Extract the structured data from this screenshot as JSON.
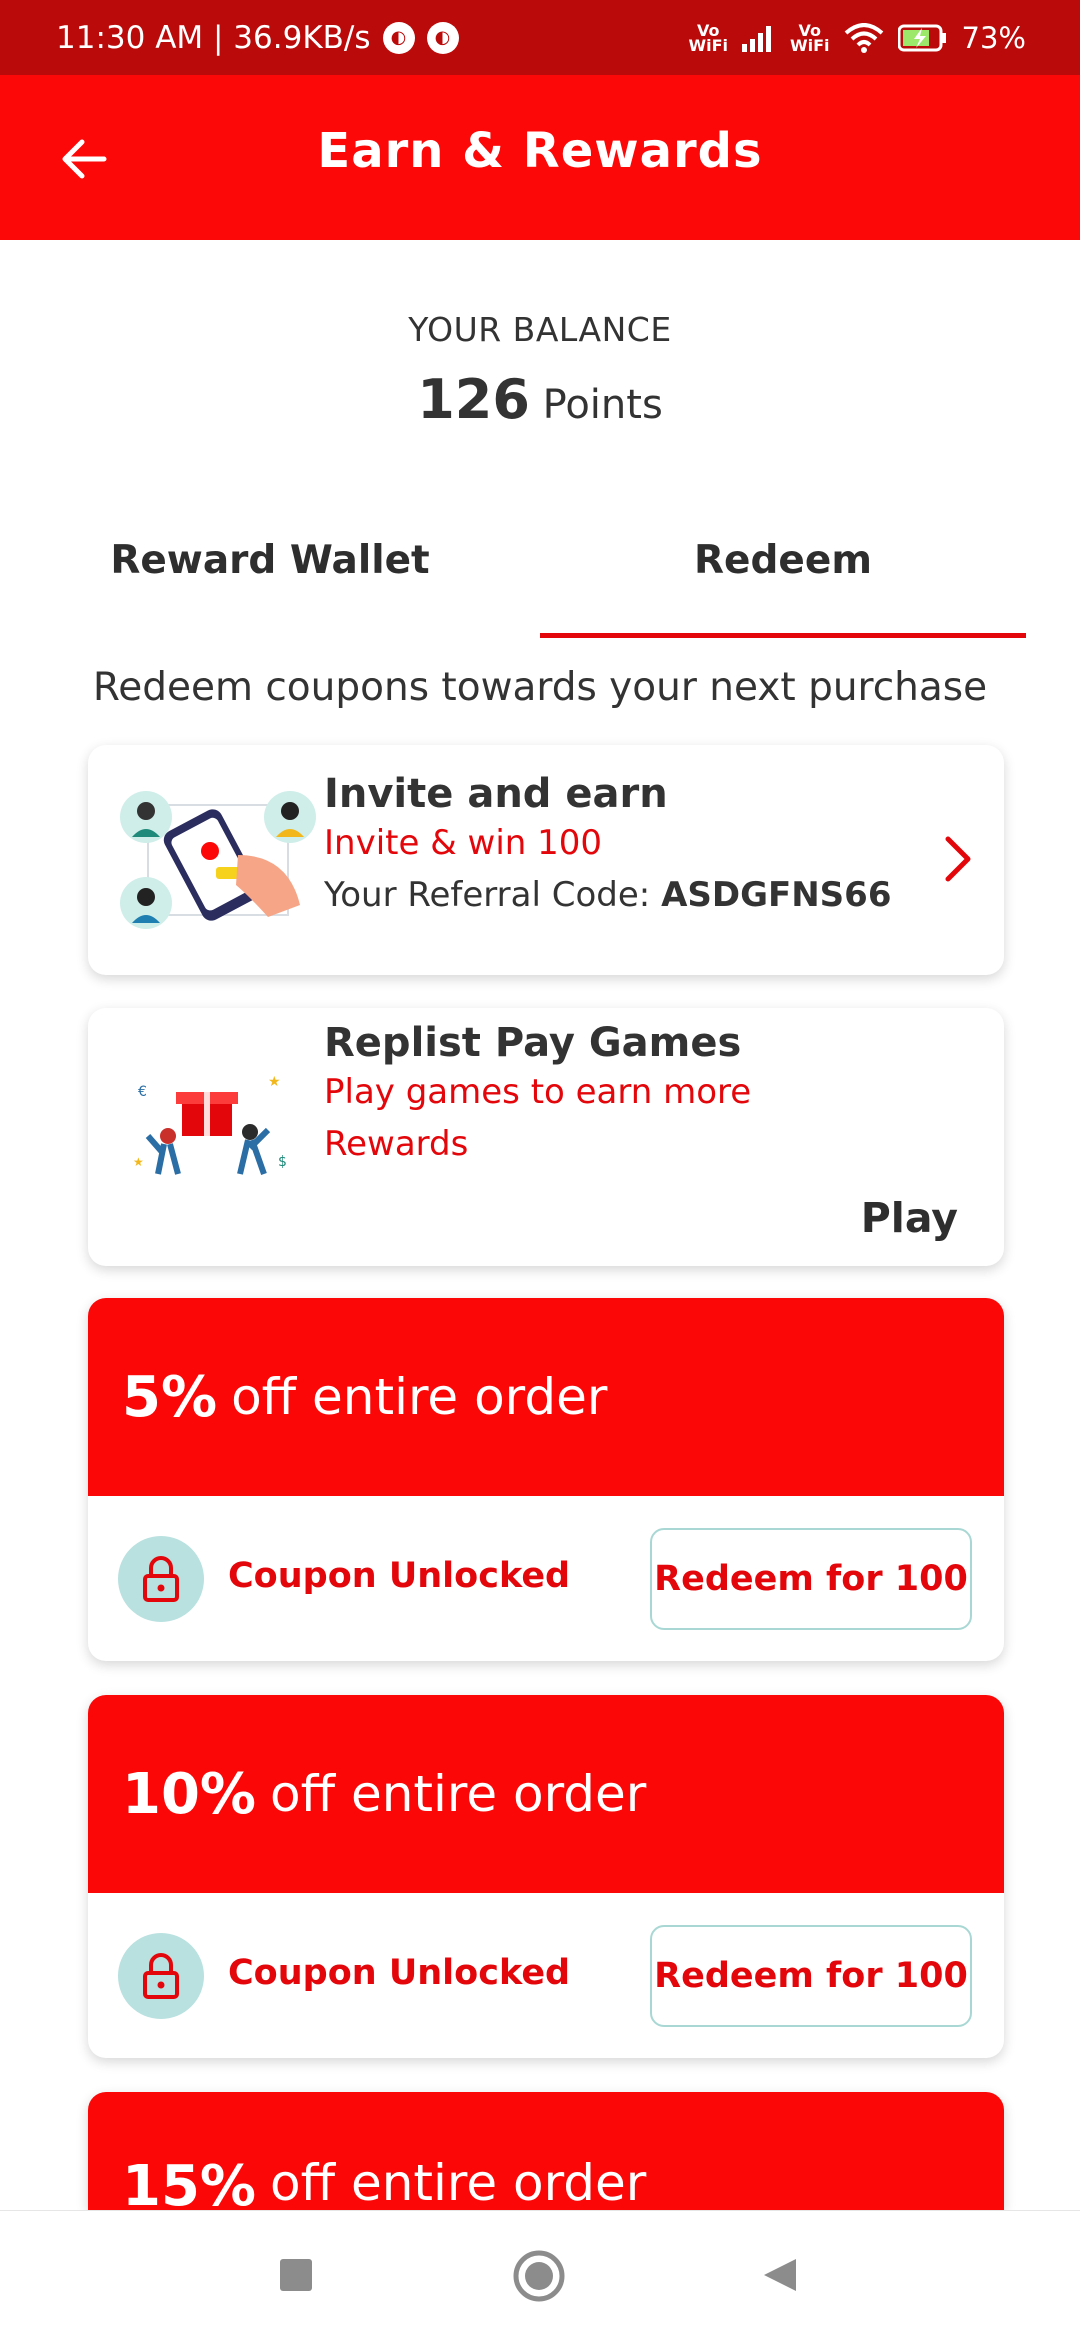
{
  "status_bar": {
    "time_speed": "11:30 AM | 36.9KB/s",
    "battery": "73%",
    "vowifi_top": "Vo",
    "vowifi_bottom": "WiFi"
  },
  "header": {
    "title": "Earn & Rewards",
    "back_icon": "arrow-left-icon"
  },
  "balance": {
    "label": "YOUR BALANCE",
    "value": "126",
    "unit": "Points"
  },
  "tabs": [
    {
      "label": "Reward Wallet",
      "active": false
    },
    {
      "label": "Redeem",
      "active": true
    }
  ],
  "subtitle": "Redeem coupons towards your next purchase",
  "invite_card": {
    "title": "Invite and earn",
    "subtitle": "Invite & win 100",
    "referral_label": "Your Referral Code:",
    "referral_code": "ASDGFNS66"
  },
  "games_card": {
    "title": "Replist Pay Games",
    "line1": "Play games to earn more",
    "line2": "Rewards",
    "action": "Play"
  },
  "coupons": [
    {
      "percent": "5%",
      "label": "off entire order",
      "status": "Coupon Unlocked",
      "button": "Redeem for 100"
    },
    {
      "percent": "10%",
      "label": "off entire order",
      "status": "Coupon Unlocked",
      "button": "Redeem for 100"
    },
    {
      "percent": "15%",
      "label": "off entire order"
    }
  ],
  "colors": {
    "primary_red": "#fc0808",
    "status_bar": "#bb0a0a",
    "accent_text": "#e3070b",
    "lock_bg": "#b8e1df"
  }
}
